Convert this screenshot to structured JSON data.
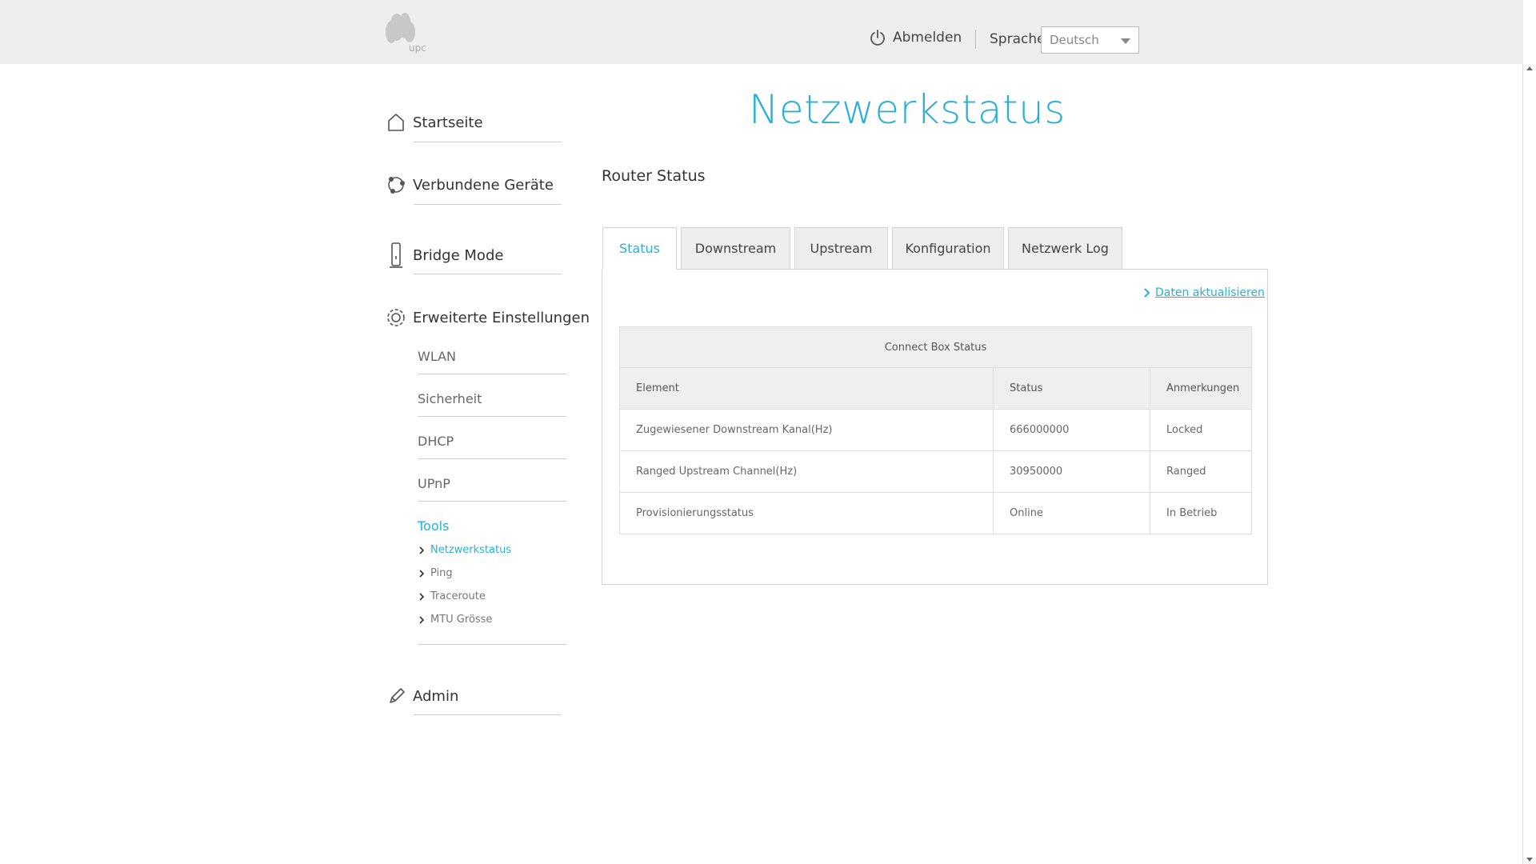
{
  "header": {
    "logo_text": "upc",
    "logout_label": "Abmelden",
    "language_label": "Sprache",
    "language_selected": "Deutsch"
  },
  "sidebar": {
    "startseite": "Startseite",
    "verbundene_geraete": "Verbundene Geräte",
    "bridge_mode": "Bridge Mode",
    "erweiterte_einstellungen": "Erweiterte Einstellungen",
    "sub_items": [
      "WLAN",
      "Sicherheit",
      "DHCP",
      "UPnP",
      "Tools"
    ],
    "tools": [
      "Netzwerkstatus",
      "Ping",
      "Traceroute",
      "MTU Grösse"
    ],
    "admin": "Admin"
  },
  "main": {
    "title": "Netzwerkstatus",
    "section_title": "Router Status",
    "tabs": [
      "Status",
      "Downstream",
      "Upstream",
      "Konfiguration",
      "Netzwerk Log"
    ],
    "active_tab": "Status",
    "refresh_link": "Daten aktualisieren",
    "table": {
      "caption": "Connect Box Status",
      "headers": [
        "Element",
        "Status",
        "Anmerkungen"
      ],
      "rows": [
        [
          "Zugewiesener Downstream Kanal(Hz)",
          "666000000",
          "Locked"
        ],
        [
          "Ranged Upstream Channel(Hz)",
          "30950000",
          "Ranged"
        ],
        [
          "Provisionierungsstatus",
          "Online",
          "In Betrieb"
        ]
      ]
    }
  },
  "colors": {
    "accent": "#2ab0d6",
    "header_bg": "#eeeeee",
    "tab_bg": "#eeeeee"
  }
}
